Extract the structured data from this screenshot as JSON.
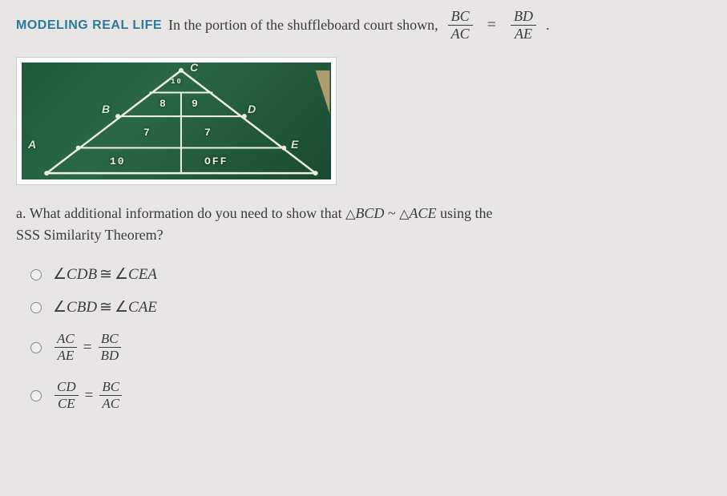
{
  "header": {
    "modeling_label": "MODELING REAL LIFE",
    "prompt": "In the portion of the shuffleboard court shown,",
    "frac1_num": "BC",
    "frac1_den": "AC",
    "equals": "=",
    "frac2_num": "BD",
    "frac2_den": "AE",
    "period": "."
  },
  "diagram": {
    "labels": {
      "A": "A",
      "B": "B",
      "C": "C",
      "D": "D",
      "E": "E"
    },
    "numbers": {
      "top_left": "8",
      "top_right": "9",
      "mid_left": "7",
      "mid_right": "7",
      "bottom_left": "10",
      "bottom_right": "OFF",
      "apex": "10"
    }
  },
  "question": {
    "part": "a.",
    "text1": "What additional information do you need to show that ",
    "tri1": "BCD",
    "tilde": "~",
    "tri2": "ACE",
    "text2": " using the",
    "text3": "SSS Similarity Theorem?"
  },
  "options": {
    "o1": {
      "a1_pre": "CDB",
      "a2_pre": "CEA"
    },
    "o2": {
      "a1_pre": "CBD",
      "a2_pre": "CAE"
    },
    "o3": {
      "f1n": "AC",
      "f1d": "AE",
      "f2n": "BC",
      "f2d": "BD"
    },
    "o4": {
      "f1n": "CD",
      "f1d": "CE",
      "f2n": "BC",
      "f2d": "AC"
    }
  }
}
